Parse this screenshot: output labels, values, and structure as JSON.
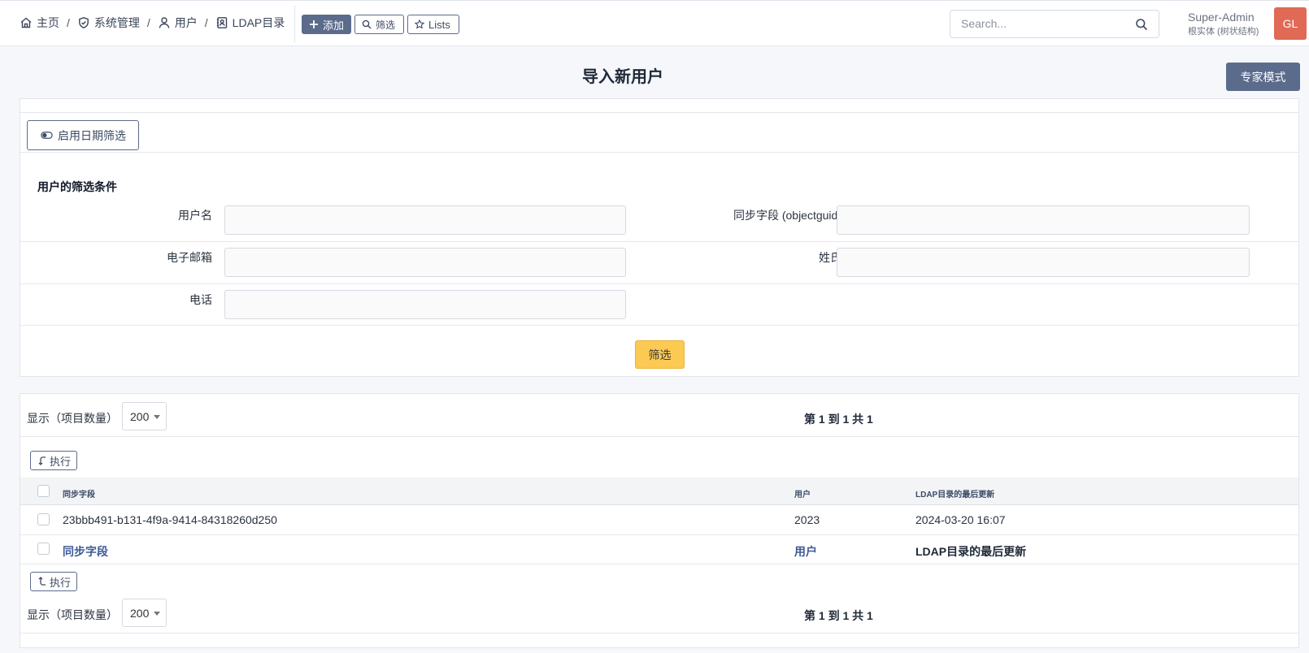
{
  "breadcrumb": {
    "home": "主页",
    "admin": "系统管理",
    "users": "用户",
    "ldap": "LDAP目录",
    "separator": "/"
  },
  "toolbar": {
    "add_label": "添加",
    "filter_label": "筛选",
    "lists_label": "Lists"
  },
  "search": {
    "placeholder": "Search..."
  },
  "user": {
    "name": "Super-Admin",
    "entity": "根实体 (树状结构)",
    "initials": "GL",
    "avatar_color": "#e06a55"
  },
  "page": {
    "title": "导入新用户",
    "expert_mode_label": "专家模式"
  },
  "filters": {
    "date_filter_label": "启用日期筛选",
    "criteria_title": "用户的筛选条件",
    "fields": {
      "username": {
        "label": "用户名",
        "value": ""
      },
      "sync_field": {
        "label": "同步字段 (objectguid)",
        "value": ""
      },
      "email": {
        "label": "电子邮箱",
        "value": ""
      },
      "lastname": {
        "label": "姓氏",
        "value": ""
      },
      "phone": {
        "label": "电话",
        "value": ""
      }
    },
    "submit_label": "筛选",
    "submit_color": "#fcc953"
  },
  "results": {
    "show_label": "显示（项目数量）",
    "page_size": "200",
    "pagination_text": "第 1 到 1 共 1",
    "execute_label": "执行",
    "columns": [
      "同步字段",
      "用户",
      "LDAP目录的最后更新"
    ],
    "rows": [
      [
        "23bbb491-b131-4f9a-9414-84318260d250",
        "2023",
        "2024-03-20 16:07"
      ]
    ],
    "footer_columns": [
      "同步字段",
      "用户",
      "LDAP目录的最后更新"
    ]
  },
  "colors": {
    "accent": "#5b6b8c",
    "link": "#3d5a96"
  }
}
